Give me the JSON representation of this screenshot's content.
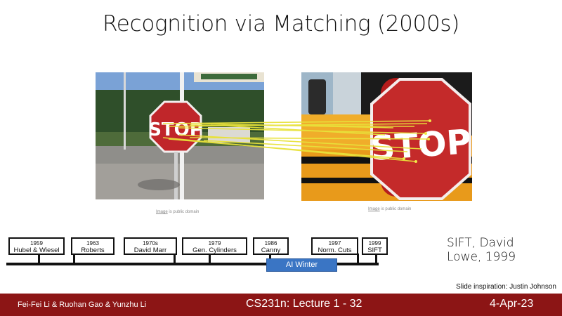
{
  "slide": {
    "title": "Recognition via Matching (2000s)"
  },
  "images": {
    "left_credit_link": "Image",
    "left_credit_text": " is public domain",
    "right_credit_link": "Image",
    "right_credit_text": " is public domain",
    "left_sign_text": "STOP",
    "right_sign_text": "STOP"
  },
  "timeline": {
    "events": [
      {
        "year": "1959",
        "name": "Hubel & Wiesel"
      },
      {
        "year": "1963",
        "name": "Roberts"
      },
      {
        "year": "1970s",
        "name": "David Marr"
      },
      {
        "year": "1979",
        "name": "Gen. Cylinders"
      },
      {
        "year": "1986",
        "name": "Canny"
      },
      {
        "year": "1997",
        "name": "Norm. Cuts"
      },
      {
        "year": "1999",
        "name": "SIFT"
      }
    ],
    "ai_winter_label": "AI Winter"
  },
  "sift_note": {
    "line1": "SIFT, David",
    "line2": "Lowe, 1999"
  },
  "inspiration": "Slide inspiration: Justin Johnson",
  "footer": {
    "authors": "Fei-Fei Li & Ruohan Gao & Yunzhu Li",
    "course": "CS231n: Lecture 1 -  32",
    "date": "4-Apr-23"
  },
  "colors": {
    "footer_bg": "#8c1515",
    "ai_winter": "#3a75c4",
    "match_lines": "#e8e23a"
  }
}
